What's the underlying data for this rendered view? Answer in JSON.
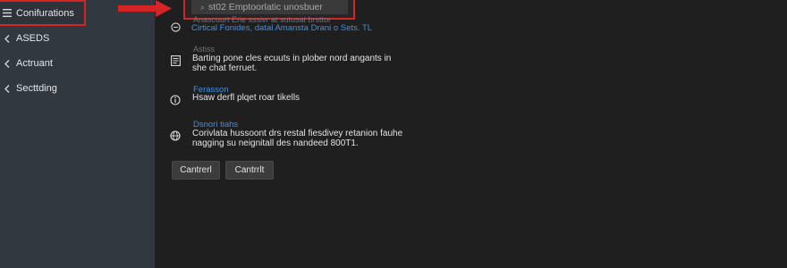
{
  "sidebar": {
    "items": [
      {
        "label": "Conifurations",
        "icon": "menu-icon",
        "active": true
      },
      {
        "label": "ASEDS",
        "icon": "chevron-left-icon"
      },
      {
        "label": "Actruant",
        "icon": "chevron-left-icon"
      },
      {
        "label": "Secttding",
        "icon": "chevron-left-icon"
      }
    ]
  },
  "search": {
    "value": "st02 Emptoorlatic unosbuer",
    "icon": "search-icon"
  },
  "content": {
    "faint_header": "Anascuurt Erie sssivr at sutusat brsttor",
    "link_line": "Cirtical Fonides, datal Amansta Drani o Sets. TL",
    "section1": {
      "caption": "Astiss",
      "text": "Barting pone cles ecuuts in plober nord angants in she chat ferruet.",
      "icon": "document-icon"
    },
    "section2": {
      "caption": "Ferasson",
      "text": "Hsaw derfl plqet roar tikells",
      "icon": "info-icon"
    },
    "section3": {
      "caption": "Dsnori tiahs",
      "text": "Corivlata hussoont drs restal fiesdivey retanion fauhe nagging su neignitall des nandeed 800T1.",
      "icon": "globe-icon"
    }
  },
  "buttons": {
    "primary": "Cantrerl",
    "secondary": "Cantrrlt"
  },
  "colors": {
    "highlight": "#d32525",
    "link": "#3f8fe6",
    "sidebar_bg": "#323840",
    "main_bg": "#1f1f1f"
  }
}
